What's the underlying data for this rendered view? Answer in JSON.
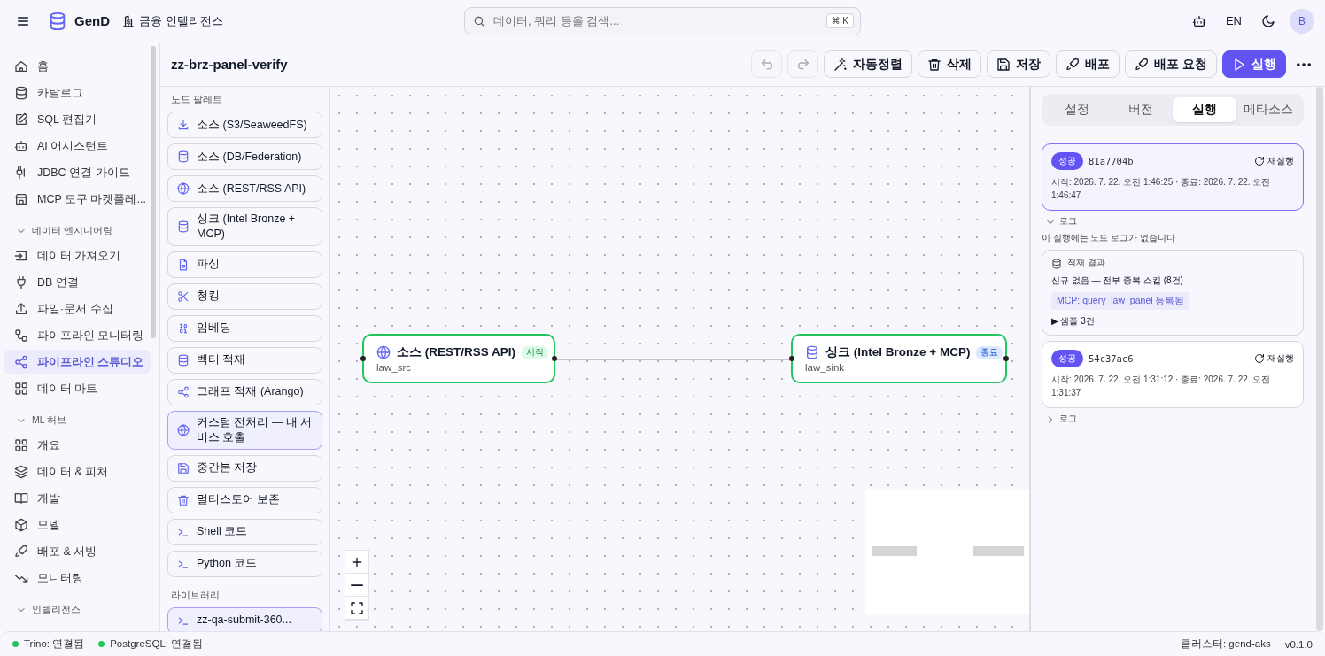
{
  "topbar": {
    "brand": "GenD",
    "workspace": "금융 인텔리전스",
    "search": {
      "placeholder": "데이터, 쿼리 등을 검색...",
      "shortcut": "⌘ K"
    },
    "language": "EN",
    "avatar": "B"
  },
  "sidebar": {
    "items": [
      {
        "label": "홈",
        "selected": false
      },
      {
        "label": "카탈로그",
        "selected": false
      },
      {
        "label": "SQL 편집기",
        "selected": false
      },
      {
        "label": "AI 어시스턴트",
        "selected": false
      },
      {
        "label": "JDBC 연결 가이드",
        "selected": false
      },
      {
        "label": "MCP 도구 마켓플레...",
        "selected": false
      }
    ],
    "groups": [
      {
        "label": "데이터 엔지니어링",
        "expanded": true,
        "items": [
          {
            "label": "데이터 가져오기",
            "selected": false
          },
          {
            "label": "DB 연결",
            "selected": false
          },
          {
            "label": "파일·문서 수집",
            "selected": false
          },
          {
            "label": "파이프라인 모니터링",
            "selected": false
          },
          {
            "label": "파이프라인 스튜디오",
            "selected": true
          },
          {
            "label": "데이터 마트",
            "selected": false
          }
        ]
      },
      {
        "label": "ML 허브",
        "expanded": true,
        "items": [
          {
            "label": "개요",
            "selected": false
          },
          {
            "label": "데이터 & 피처",
            "selected": false
          },
          {
            "label": "개발",
            "selected": false
          },
          {
            "label": "모델",
            "selected": false
          },
          {
            "label": "배포 & 서빙",
            "selected": false
          },
          {
            "label": "모니터링",
            "selected": false
          }
        ]
      },
      {
        "label": "인텔리전스",
        "expanded": true
      }
    ]
  },
  "pipeline": {
    "title": "zz-brz-panel-verify",
    "toolbar": [
      {
        "kind": "undo",
        "disabled": true
      },
      {
        "kind": "redo",
        "disabled": true
      },
      {
        "kind": "outline",
        "label": "자동정렬"
      },
      {
        "kind": "outline",
        "label": "삭제"
      },
      {
        "kind": "outline",
        "label": "저장"
      },
      {
        "kind": "outline",
        "label": "배포"
      },
      {
        "kind": "outline",
        "label": "배포 요청"
      },
      {
        "kind": "primary",
        "label": "실행"
      },
      {
        "kind": "more"
      }
    ]
  },
  "palette": {
    "title": "노드 팔레트",
    "items": [
      {
        "label": "소스 (S3/SeaweedFS)",
        "selected": false
      },
      {
        "label": "소스 (DB/Federation)",
        "selected": false
      },
      {
        "label": "소스 (REST/RSS API)",
        "selected": false
      },
      {
        "label": "싱크 (Intel Bronze + MCP)",
        "selected": false
      },
      {
        "label": "파싱",
        "selected": false
      },
      {
        "label": "청킹",
        "selected": false
      },
      {
        "label": "임베딩",
        "selected": false
      },
      {
        "label": "벡터 적재",
        "selected": false
      },
      {
        "label": "그래프 적재 (Arango)",
        "selected": false
      },
      {
        "label": "커스텀 전처리 — 내 서비스 호출",
        "selected": true
      },
      {
        "label": "중간본 저장",
        "selected": false
      },
      {
        "label": "멀티스토어 보존",
        "selected": false
      },
      {
        "label": "Shell 코드",
        "selected": false
      },
      {
        "label": "Python 코드",
        "selected": false
      }
    ],
    "library_title": "라이브러리",
    "library": [
      {
        "label": "zz-qa-submit-360...",
        "selected": true
      }
    ]
  },
  "canvas": {
    "nodes": [
      {
        "title": "소스 (REST/RSS API)",
        "badge": "시작",
        "kind": "start",
        "name": "law_src"
      },
      {
        "title": "싱크 (Intel Bronze + MCP)",
        "badge": "종료",
        "kind": "end",
        "name": "law_sink"
      }
    ]
  },
  "panel": {
    "tabs": [
      {
        "label": "설정",
        "selected": false
      },
      {
        "label": "버전",
        "selected": false
      },
      {
        "label": "실행",
        "selected": true
      },
      {
        "label": "메타소스",
        "selected": false
      }
    ],
    "runs": [
      {
        "status": "성공",
        "id": "81a7704b",
        "rerun": "재실행",
        "time": "시작: 2026. 7. 22. 오전 1:46:25 · 종료: 2026. 7. 22. 오전 1:46:47",
        "selected": true,
        "log": {
          "label": "로그",
          "expanded": true,
          "message": "이 실행에는 노드 로그가 없습니다"
        },
        "result": {
          "title": "적재 결과",
          "summary": "신규 없음 — 전부 중복 스킵 (8건)",
          "tag": "MCP: query_law_panel 등록됨",
          "samples": "▶ 샘플 3건"
        }
      },
      {
        "status": "성공",
        "id": "54c37ac6",
        "rerun": "재실행",
        "time": "시작: 2026. 7. 22. 오전 1:31:12 · 종료: 2026. 7. 22. 오전 1:31:37",
        "selected": false,
        "log": {
          "label": "로그",
          "expanded": false
        }
      }
    ]
  },
  "status_bar": {
    "connections": [
      {
        "label": "Trino: 연결됨",
        "color": "#22c55e"
      },
      {
        "label": "PostgreSQL: 연결됨",
        "color": "#22c55e"
      }
    ],
    "cluster": "클러스터: gend-aks",
    "version": "v0.1.0"
  }
}
